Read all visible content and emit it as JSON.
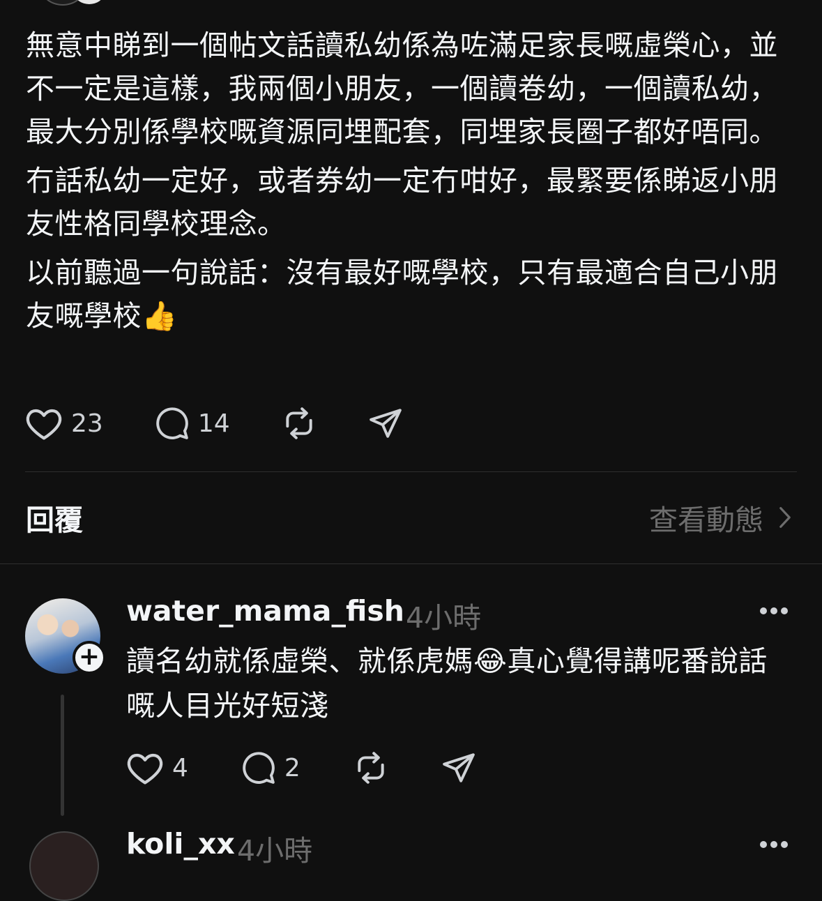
{
  "post": {
    "paragraphs": [
      "無意中睇到一個帖文話讀私幼係為咗滿足家長嘅虛榮心，並不一定是這樣，我兩個小朋友，一個讀卷幼，一個讀私幼，最大分別係學校嘅資源同埋配套，同埋家長圈子都好唔同。",
      "冇話私幼一定好，或者券幼一定冇咁好，最緊要係睇返小朋友性格同學校理念。",
      "以前聽過一句說話：沒有最好嘅學校，只有最適合自己小朋友嘅學校👍"
    ],
    "like_count": "23",
    "comment_count": "14"
  },
  "replies_header": {
    "title": "回覆",
    "activity_link": "查看動態"
  },
  "reply": {
    "username": "water_mama_fish",
    "time": "4小時",
    "text": "讀名幼就係虛榮、就係虎媽😂真心覺得講呢番說話嘅人目光好短淺",
    "like_count": "4",
    "comment_count": "2"
  },
  "next_reply": {
    "username": "koli_xx",
    "time": "4小時"
  },
  "icons": {
    "like": "heart-icon",
    "comment": "comment-bubble-icon",
    "repost": "repost-icon",
    "share": "send-icon",
    "more": "more-dots-icon",
    "chevron": "chevron-right-icon",
    "follow": "plus-icon"
  },
  "colors": {
    "background": "#101010",
    "text": "#f3f5f7",
    "muted": "#6d6d6d"
  }
}
